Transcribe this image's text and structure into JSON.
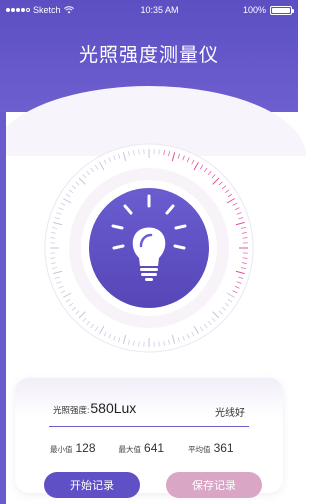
{
  "status_bar": {
    "carrier": "Sketch",
    "time": "10:35 AM",
    "battery": "100%",
    "battery_level": 1.0
  },
  "title": "光照强度测量仪",
  "dial": {
    "icon": "light-bulb-icon",
    "accent": "#e04fa0",
    "inner_color": "#5a4cc0"
  },
  "reading": {
    "label": "光照强度:",
    "value": "580Lux",
    "status": "光线好"
  },
  "stats": {
    "min_label": "最小值",
    "min_value": "128",
    "max_label": "最大值",
    "max_value": "641",
    "avg_label": "平均值",
    "avg_value": "361"
  },
  "buttons": {
    "start": "开始记录",
    "save": "保存记录"
  },
  "colors": {
    "brand": "#5b4fc2",
    "save_button": "#d9a6c6"
  }
}
